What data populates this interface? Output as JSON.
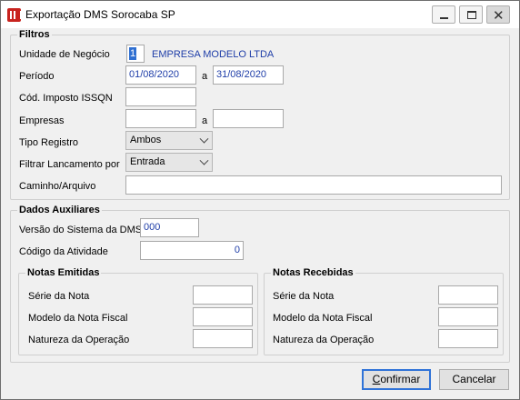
{
  "window": {
    "title": "Exportação DMS Sorocaba SP"
  },
  "filtros": {
    "title": "Filtros",
    "unidade_label": "Unidade de Negócio",
    "unidade_value": "1",
    "empresa_name": "EMPRESA MODELO LTDA",
    "periodo_label": "Período",
    "periodo_inicio": "01/08/2020",
    "periodo_sep": "a",
    "periodo_fim": "31/08/2020",
    "cod_imposto_label": "Cód. Imposto ISSQN",
    "cod_imposto_value": "",
    "empresas_label": "Empresas",
    "empresas_inicio": "",
    "empresas_sep": "a",
    "empresas_fim": "",
    "tipo_registro_label": "Tipo Registro",
    "tipo_registro_value": "Ambos",
    "filtrar_label": "Filtrar Lancamento por",
    "filtrar_value": "Entrada",
    "caminho_label": "Caminho/Arquivo",
    "caminho_value": ""
  },
  "auxiliares": {
    "title": "Dados Auxiliares",
    "versao_label": "Versão do Sistema da DMS",
    "versao_value": "000",
    "codigo_atividade_label": "Código da Atividade",
    "codigo_atividade_value": "0"
  },
  "emitidas": {
    "title": "Notas Emitidas",
    "serie_label": "Série da Nota",
    "serie_value": "",
    "modelo_label": "Modelo da Nota Fiscal",
    "modelo_value": "",
    "natureza_label": "Natureza da Operação",
    "natureza_value": ""
  },
  "recebidas": {
    "title": "Notas Recebidas",
    "serie_label": "Série da Nota",
    "serie_value": "",
    "modelo_label": "Modelo da Nota Fiscal",
    "modelo_value": "",
    "natureza_label": "Natureza da Operação",
    "natureza_value": ""
  },
  "buttons": {
    "confirmar_first": "C",
    "confirmar_rest": "onfirmar",
    "cancelar": "Cancelar"
  },
  "colors": {
    "accent": "#2f73d8",
    "link_text": "#1f3ea8",
    "app_icon": "#c8231e"
  }
}
